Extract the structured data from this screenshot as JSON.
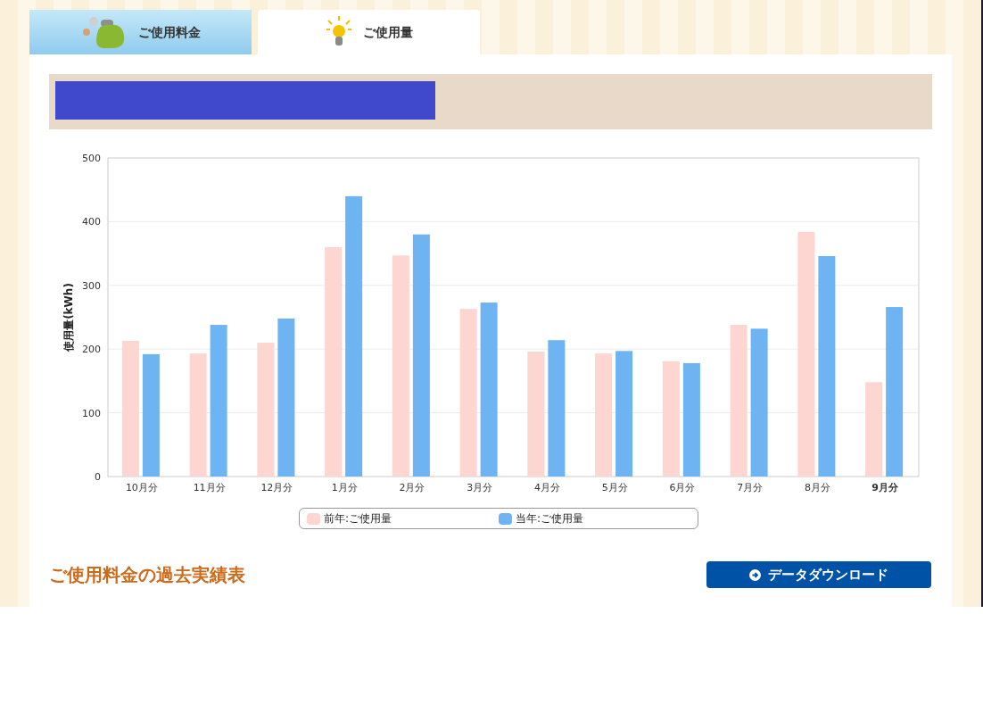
{
  "tabs": [
    {
      "label": "ご使用料金",
      "kind": "purse",
      "selected": false
    },
    {
      "label": "ご使用量",
      "kind": "bulb",
      "selected": true
    }
  ],
  "chart": {
    "chart_data": {
      "type": "bar",
      "ylabel": "使用量(kWh)",
      "categories": [
        "10月分",
        "11月分",
        "12月分",
        "1月分",
        "2月分",
        "3月分",
        "4月分",
        "5月分",
        "6月分",
        "7月分",
        "8月分",
        "9月分"
      ],
      "ylim": [
        0,
        500
      ],
      "grid": true,
      "legend": "bottom",
      "yticks": [
        0,
        100,
        200,
        300,
        400,
        500
      ],
      "series": [
        {
          "name": "前年:ご使用量",
          "color": "#fdd5d1",
          "values": [
            213,
            193,
            210,
            360,
            347,
            263,
            196,
            193,
            181,
            238,
            384,
            148
          ]
        },
        {
          "name": "当年:ご使用量",
          "color": "#6eb3f2",
          "values": [
            192,
            238,
            248,
            440,
            380,
            273,
            214,
            197,
            178,
            232,
            346,
            266
          ]
        }
      ]
    }
  },
  "section": {
    "heading": "ご使用料金の過去実績表",
    "download_button": "データダウンロード"
  }
}
